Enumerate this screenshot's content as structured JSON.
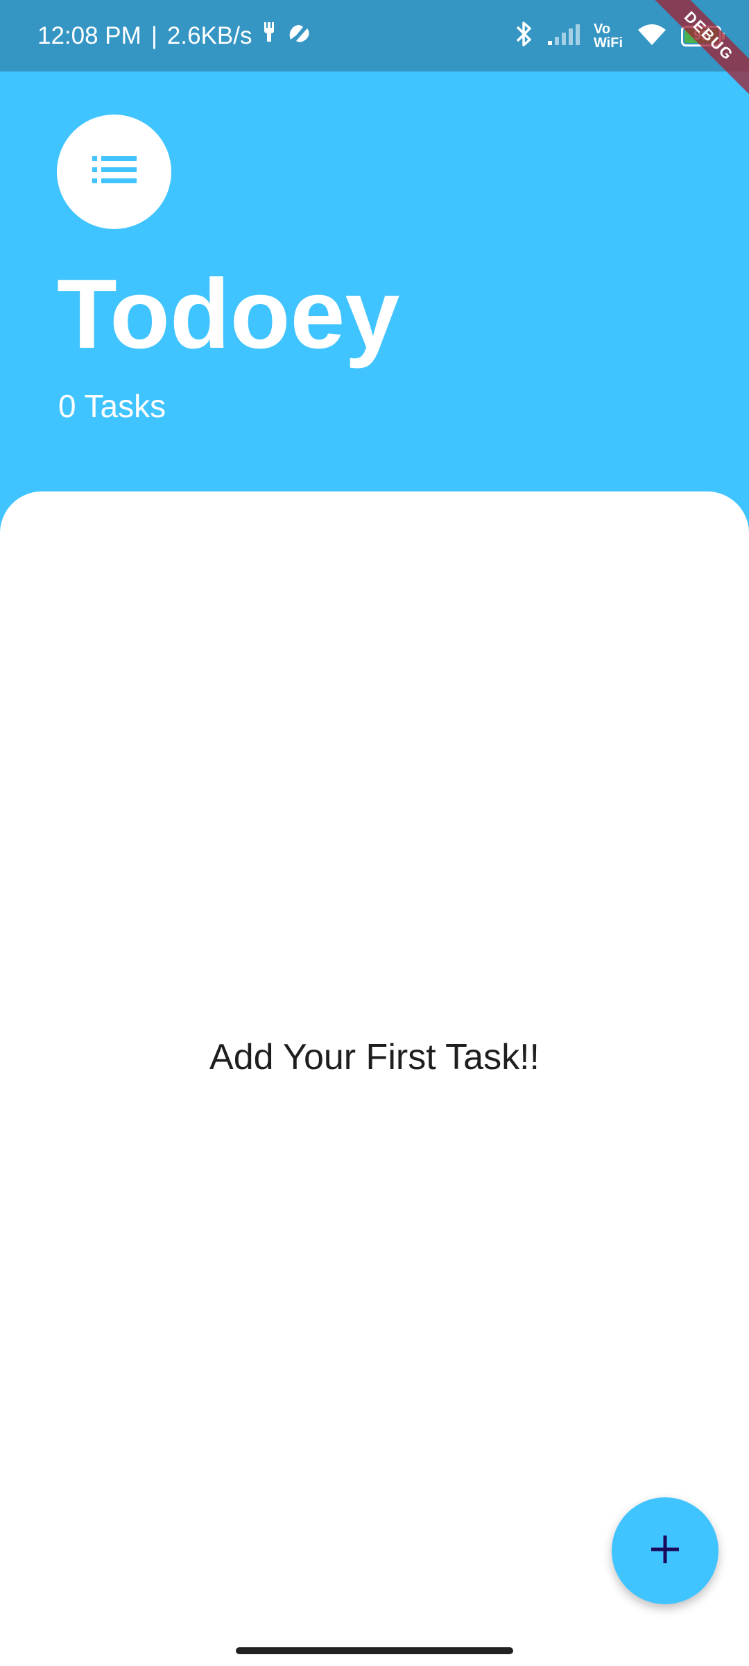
{
  "status_bar": {
    "time": "12:08 PM",
    "separator": "|",
    "network_speed": "2.6KB/s",
    "vowifi_top": "Vo",
    "vowifi_bottom": "WiFi",
    "battery_level": "91",
    "icons": [
      "notification-icon",
      "app-notification-icon",
      "bluetooth-icon",
      "signal-icon",
      "wifi-icon",
      "battery-icon"
    ]
  },
  "debug_banner": "DEBUG",
  "header": {
    "title": "Todoey",
    "task_count": "0 Tasks",
    "icon": "list-icon"
  },
  "task_list": {
    "empty_message": "Add Your First Task!!"
  },
  "fab": {
    "icon": "add-icon"
  },
  "colors": {
    "accent": "#40C4FF",
    "status_bar": "#3596C4",
    "fab_icon": "#1A0A5C",
    "text_dark": "#1e1e1e"
  }
}
